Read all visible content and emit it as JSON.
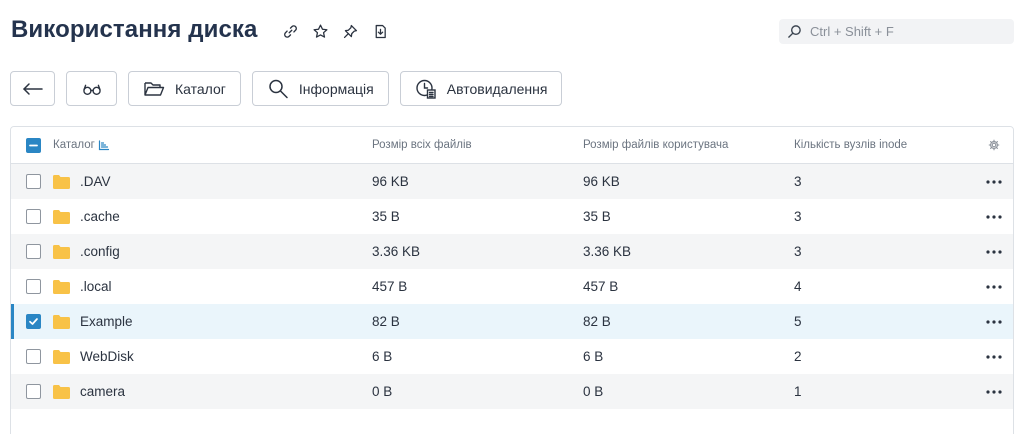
{
  "header": {
    "title": "Використання диска",
    "icons": [
      "link-icon",
      "star-icon",
      "pin-icon",
      "download-icon"
    ]
  },
  "search": {
    "placeholder": "Ctrl + Shift + F",
    "value": ""
  },
  "toolbar": {
    "back_icon": "arrow-left-icon",
    "view_icon": "glasses-icon",
    "catalog_label": "Каталог",
    "info_label": "Інформація",
    "autodelete_label": "Автовидалення"
  },
  "table": {
    "columns": {
      "name": "Каталог",
      "size_all": "Розмір всіх файлів",
      "size_user": "Розмір файлів користувача",
      "inodes": "Кількість вузлів inode"
    },
    "rows": [
      {
        "name": ".DAV",
        "size_all": "96 KB",
        "size_user": "96 KB",
        "inodes": "3",
        "checked": false
      },
      {
        "name": ".cache",
        "size_all": "35 B",
        "size_user": "35 B",
        "inodes": "3",
        "checked": false
      },
      {
        "name": ".config",
        "size_all": "3.36 KB",
        "size_user": "3.36 KB",
        "inodes": "3",
        "checked": false
      },
      {
        "name": ".local",
        "size_all": "457 B",
        "size_user": "457 B",
        "inodes": "4",
        "checked": false
      },
      {
        "name": "Example",
        "size_all": "82 B",
        "size_user": "82 B",
        "inodes": "5",
        "checked": true
      },
      {
        "name": "WebDisk",
        "size_all": "6 B",
        "size_user": "6 B",
        "inodes": "2",
        "checked": false
      },
      {
        "name": "camera",
        "size_all": "0 B",
        "size_user": "0 B",
        "inodes": "1",
        "checked": false
      }
    ]
  },
  "colors": {
    "accent": "#2a86c4",
    "folder": "#f8c247",
    "title": "#24334d",
    "row_alt": "#f4f5f6",
    "row_selected": "#eaf5fb"
  }
}
